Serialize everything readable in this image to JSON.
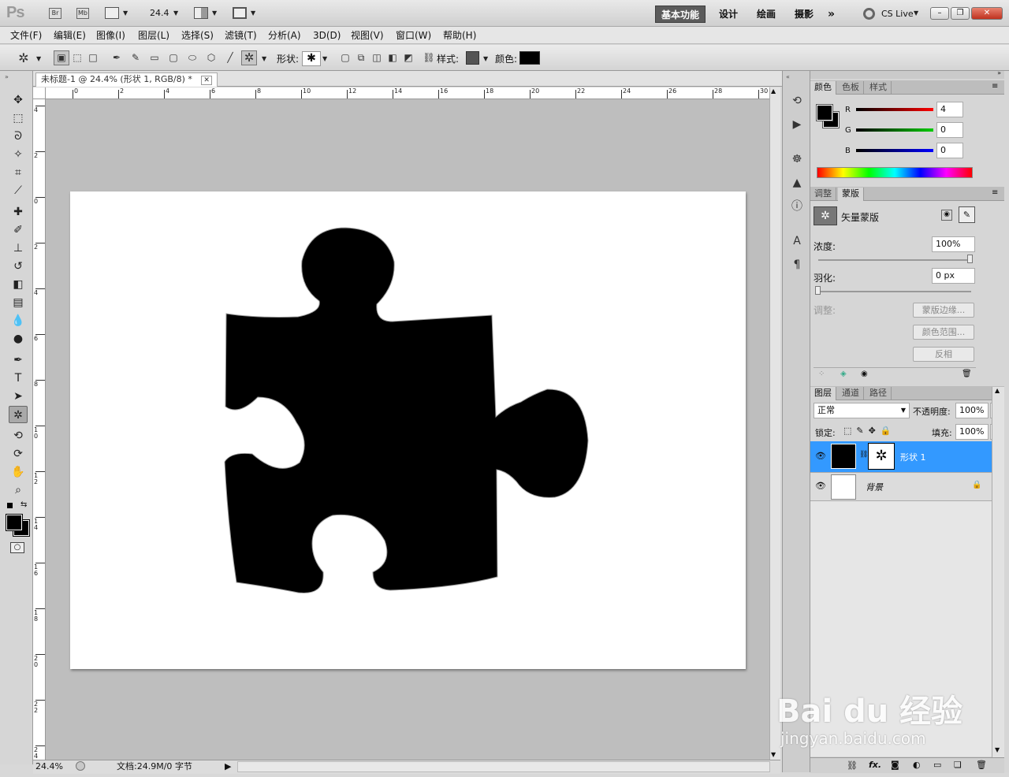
{
  "app": {
    "logo": "Ps",
    "br": "Br",
    "mb": "Mb",
    "zoom": "24.4",
    "workspaces": [
      "基本功能",
      "设计",
      "绘画",
      "摄影"
    ],
    "overflow": "»",
    "cslive": "CS Live"
  },
  "menu": [
    "文件(F)",
    "编辑(E)",
    "图像(I)",
    "图层(L)",
    "选择(S)",
    "滤镜(T)",
    "分析(A)",
    "3D(D)",
    "视图(V)",
    "窗口(W)",
    "帮助(H)"
  ],
  "options": {
    "shape_label": "形状:",
    "style_label": "样式:",
    "color_label": "颜色:",
    "colors": {
      "style": "#555555",
      "fill": "#000000"
    }
  },
  "document": {
    "tab_title": "未标题-1 @ 24.4% (形状 1, RGB/8) *",
    "ruler_top": [
      "0",
      "2",
      "4",
      "6",
      "8",
      "10",
      "12",
      "14",
      "16",
      "18",
      "20",
      "22",
      "24",
      "26",
      "28",
      "30"
    ],
    "ruler_left": [
      "4",
      "2",
      "0",
      "2",
      "4",
      "6",
      "8",
      "10",
      "12",
      "14",
      "16",
      "18",
      "20",
      "22",
      "24"
    ]
  },
  "status": {
    "zoom": "24.4%",
    "doc": "文档:24.9M/0 字节"
  },
  "color_panel": {
    "tabs": [
      "颜色",
      "色板",
      "样式"
    ],
    "r_label": "R",
    "g_label": "G",
    "b_label": "B",
    "r": "4",
    "g": "0",
    "b": "0"
  },
  "mask_panel": {
    "tabs": [
      "调整",
      "蒙版"
    ],
    "title": "矢量蒙版",
    "density_label": "浓度:",
    "density": "100%",
    "feather_label": "羽化:",
    "feather": "0 px",
    "refine_label": "调整:",
    "btn_edge": "蒙版边缘...",
    "btn_range": "颜色范围...",
    "btn_invert": "反相"
  },
  "layers_panel": {
    "tabs": [
      "图层",
      "通道",
      "路径"
    ],
    "blend": "正常",
    "opacity_label": "不透明度:",
    "opacity": "100%",
    "lock_label": "锁定:",
    "fill_label": "填充:",
    "fill": "100%",
    "layers": [
      {
        "name": "形状 1"
      },
      {
        "name": "背景"
      }
    ],
    "footer_fx": "fx."
  },
  "watermark": {
    "brand": "Bai du 经验",
    "url": "jingyan.baidu.com"
  }
}
